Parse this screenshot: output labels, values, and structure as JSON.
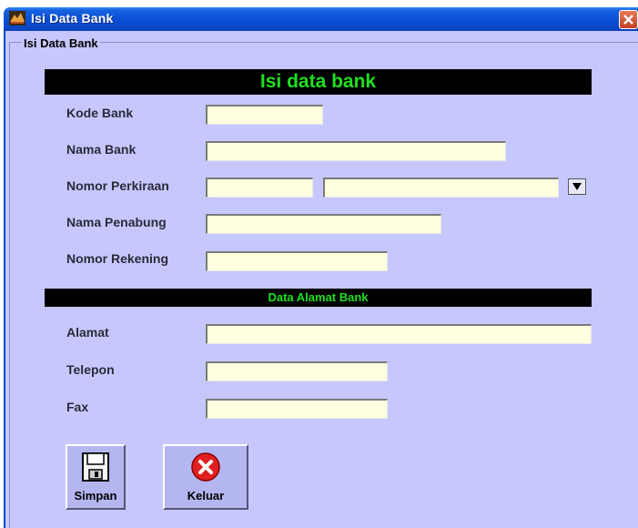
{
  "window": {
    "title": "Isi Data Bank"
  },
  "group": {
    "label": "Isi Data Bank"
  },
  "banner": {
    "main": "Isi data bank",
    "address": "Data Alamat Bank"
  },
  "fields": {
    "kode_bank": {
      "label": "Kode Bank",
      "value": ""
    },
    "nama_bank": {
      "label": "Nama Bank",
      "value": ""
    },
    "nomor_perkiraan": {
      "label": "Nomor Perkiraan",
      "code": "",
      "name": ""
    },
    "nama_penabung": {
      "label": "Nama Penabung",
      "value": ""
    },
    "nomor_rekening": {
      "label": "Nomor Rekening",
      "value": ""
    },
    "alamat": {
      "label": "Alamat",
      "value": ""
    },
    "telepon": {
      "label": "Telepon",
      "value": ""
    },
    "fax": {
      "label": "Fax",
      "value": ""
    }
  },
  "buttons": {
    "save": "Simpan",
    "exit": "Keluar"
  },
  "icons": {
    "app": "bank-app-icon",
    "close": "close-icon",
    "dropdown": "dropdown-arrow-icon",
    "save": "floppy-disk-icon",
    "exit": "red-x-icon"
  },
  "colors": {
    "titlebar": "#0a48c8",
    "client": "#c6c8fd",
    "banner_bg": "#000000",
    "banner_text": "#1ee01e",
    "field_bg": "#ffffe0"
  }
}
